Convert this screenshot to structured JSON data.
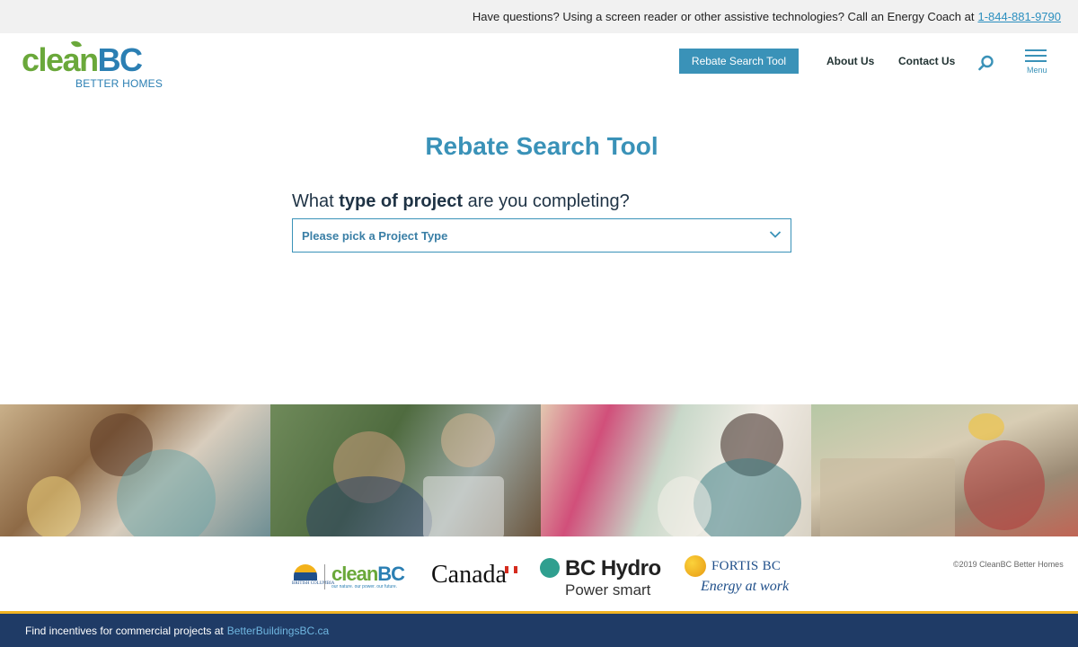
{
  "topbar": {
    "message": "Have questions? Using a screen reader or other assistive technologies?  Call an Energy Coach at",
    "phone": "1-844-881-9790"
  },
  "header": {
    "logo_clean": "clean",
    "logo_bc": "BC",
    "logo_sub": "BETTER HOMES",
    "rebate_button": "Rebate Search Tool",
    "about": "About Us",
    "contact": "Contact Us",
    "menu_label": "Menu"
  },
  "main": {
    "title": "Rebate Search Tool",
    "question_pre": "What ",
    "question_bold": "type of project",
    "question_post": " are you completing?",
    "select_placeholder": "Please pick a Project Type"
  },
  "partners": {
    "bc_gov_text": "BRITISH COLUMBIA",
    "cleanbc_clean": "clean",
    "cleanbc_bc": "BC",
    "cleanbc_tag": "our nature. our power. our future.",
    "canada": "Canada",
    "bchydro_name": "BC Hydro",
    "bchydro_tag": "Power smart",
    "fortis_name": "FORTIS BC",
    "fortis_tag": "Energy at work",
    "copyright": "©2019 CleanBC Better Homes"
  },
  "footer": {
    "text": "Find incentives for commercial projects at",
    "link": "BetterBuildingsBC.ca"
  },
  "colors": {
    "accent": "#3a92b8",
    "green": "#6aa83a",
    "footer_bg": "#1f3b66",
    "footer_border": "#f0b323"
  }
}
